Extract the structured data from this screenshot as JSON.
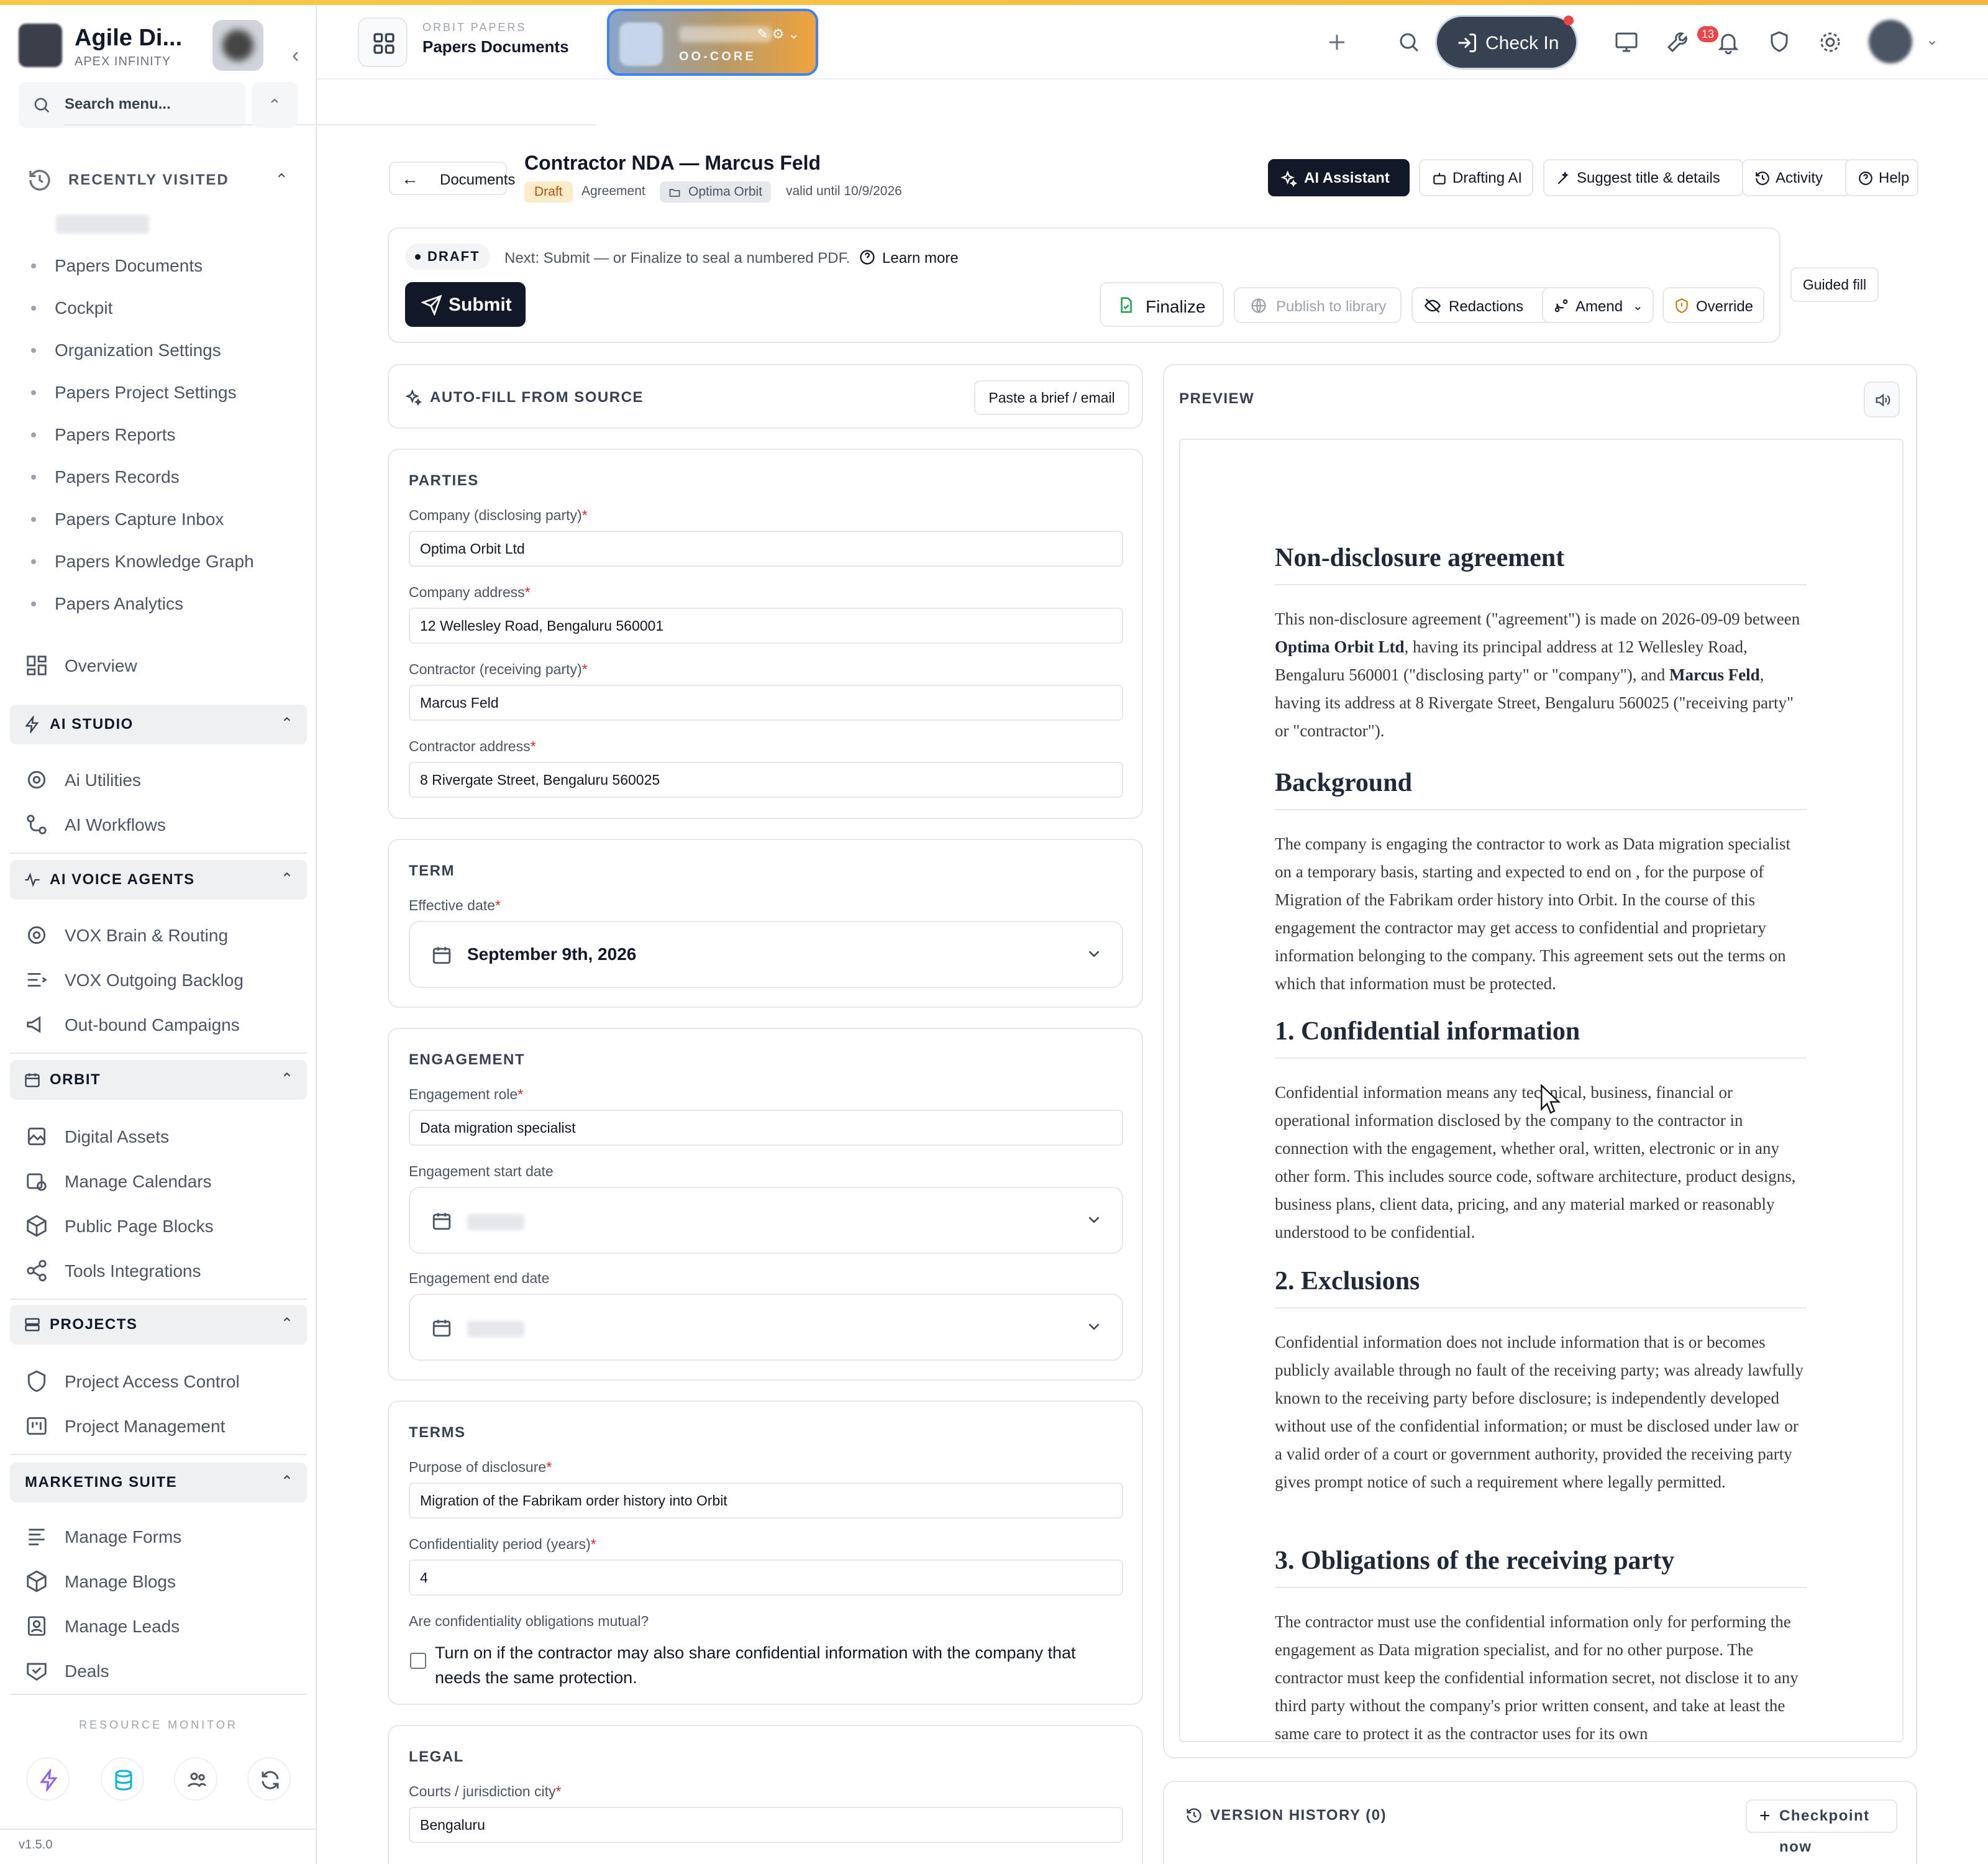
{
  "brand": {
    "title": "Agile Di...",
    "subtitle": "APEX INFINITY"
  },
  "sidebar": {
    "search_placeholder": "Search menu...",
    "recently_visited": {
      "label": "RECENTLY VISITED",
      "items": [
        "Papers Documents",
        "Cockpit",
        "Organization Settings",
        "Papers Project Settings",
        "Papers Reports",
        "Papers Records",
        "Papers Capture Inbox",
        "Papers Knowledge Graph",
        "Papers Analytics"
      ]
    },
    "overview": "Overview",
    "groups": [
      {
        "label": "AI STUDIO",
        "items": [
          "Ai Utilities",
          "AI Workflows"
        ]
      },
      {
        "label": "AI VOICE AGENTS",
        "items": [
          "VOX Brain & Routing",
          "VOX Outgoing Backlog",
          "Out-bound Campaigns"
        ]
      },
      {
        "label": "ORBIT",
        "items": [
          "Digital Assets",
          "Manage Calendars",
          "Public Page Blocks",
          "Tools Integrations"
        ]
      },
      {
        "label": "PROJECTS",
        "items": [
          "Project Access Control",
          "Project Management"
        ]
      },
      {
        "label": "MARKETING SUITE",
        "items": [
          "Manage Forms",
          "Manage Blogs",
          "Manage Leads",
          "Deals"
        ]
      }
    ],
    "resource_monitor": "RESOURCE MONITOR",
    "version": "v1.5.0"
  },
  "header": {
    "crumb_top": "ORBIT PAPERS",
    "crumb_main": "Papers Documents",
    "org_code": "OO-CORE",
    "checkin_label": "Check In",
    "notif_count": "13"
  },
  "doc": {
    "back_label": "Documents",
    "title": "Contractor NDA — Marcus Feld",
    "status_chip": "Draft",
    "type": "Agreement",
    "org": "Optima Orbit",
    "valid": "valid until 10/9/2026",
    "toolbar": {
      "ai_assistant": "AI Assistant",
      "drafting_ai": "Drafting AI",
      "suggest": "Suggest title & details",
      "activity": "Activity",
      "help": "Help"
    }
  },
  "status": {
    "pill": "DRAFT",
    "next": "Next: Submit — or Finalize to seal a numbered PDF.",
    "learn_more": "Learn more",
    "submit": "Submit",
    "finalize": "Finalize",
    "publish": "Publish to library",
    "redactions": "Redactions",
    "amend": "Amend",
    "override": "Override",
    "guided_fill": "Guided fill"
  },
  "autofill": {
    "label": "AUTO-FILL FROM SOURCE",
    "paste_button": "Paste a brief / email"
  },
  "form": {
    "parties": {
      "title": "PARTIES",
      "company_label": "Company (disclosing party)",
      "company_value": "Optima Orbit Ltd",
      "company_address_label": "Company address",
      "company_address_value": "12 Wellesley Road, Bengaluru 560001",
      "contractor_label": "Contractor (receiving party)",
      "contractor_value": "Marcus Feld",
      "contractor_address_label": "Contractor address",
      "contractor_address_value": "8 Rivergate Street, Bengaluru 560025"
    },
    "term": {
      "title": "TERM",
      "effective_label": "Effective date",
      "effective_value": "September 9th, 2026"
    },
    "engagement": {
      "title": "ENGAGEMENT",
      "role_label": "Engagement role",
      "role_value": "Data migration specialist",
      "start_label": "Engagement start date",
      "end_label": "Engagement end date"
    },
    "terms": {
      "title": "TERMS",
      "purpose_label": "Purpose of disclosure",
      "purpose_value": "Migration of the Fabrikam order history into Orbit",
      "period_label": "Confidentiality period (years)",
      "period_value": "4",
      "mutual_label": "Are confidentiality obligations mutual?",
      "mutual_text": "Turn on if the contractor may also share confidential information with the company that needs the same protection."
    },
    "legal": {
      "title": "LEGAL",
      "city_label": "Courts / jurisdiction city",
      "city_value": "Bengaluru"
    }
  },
  "preview": {
    "label": "PREVIEW",
    "h_nda": "Non-disclosure agreement",
    "p_intro_1": "This non-disclosure agreement (\"agreement\") is made on 2026-09-09 between ",
    "p_intro_company": "Optima Orbit Ltd",
    "p_intro_2": ", having its principal address at 12 Wellesley Road, Bengaluru 560001 (\"disclosing party\" or \"company\"), and ",
    "p_intro_contractor": "Marcus Feld",
    "p_intro_3": ", having its address at 8 Rivergate Street, Bengaluru 560025 (\"receiving party\" or \"contractor\").",
    "h_background": "Background",
    "p_background": "The company is engaging the contractor to work as Data migration specialist on a temporary basis, starting and expected to end on , for the purpose of Migration of the Fabrikam order history into Orbit. In the course of this engagement the contractor may get access to confidential and proprietary information belonging to the company. This agreement sets out the terms on which that information must be protected.",
    "h_1": "1. Confidential information",
    "p_1": "Confidential information means any technical, business, financial or operational information disclosed by the company to the contractor in connection with the engagement, whether oral, written, electronic or in any other form. This includes source code, software architecture, product designs, business plans, client data, pricing, and any material marked or reasonably understood to be confidential.",
    "h_2": "2. Exclusions",
    "p_2": "Confidential information does not include information that is or becomes publicly available through no fault of the receiving party; was already lawfully known to the receiving party before disclosure; is independently developed without use of the confidential information; or must be disclosed under law or a valid order of a court or government authority, provided the receiving party gives prompt notice of such a requirement where legally permitted.",
    "h_3": "3. Obligations of the receiving party",
    "p_3": "The contractor must use the confidential information only for performing the engagement as Data migration specialist, and for no other purpose. The contractor must keep the confidential information secret, not disclose it to any third party without the company's prior written consent, and take at least the same care to protect it as the contractor uses for its own"
  },
  "version_history": {
    "label": "VERSION HISTORY (0)",
    "checkpoint": "Checkpoint now"
  }
}
